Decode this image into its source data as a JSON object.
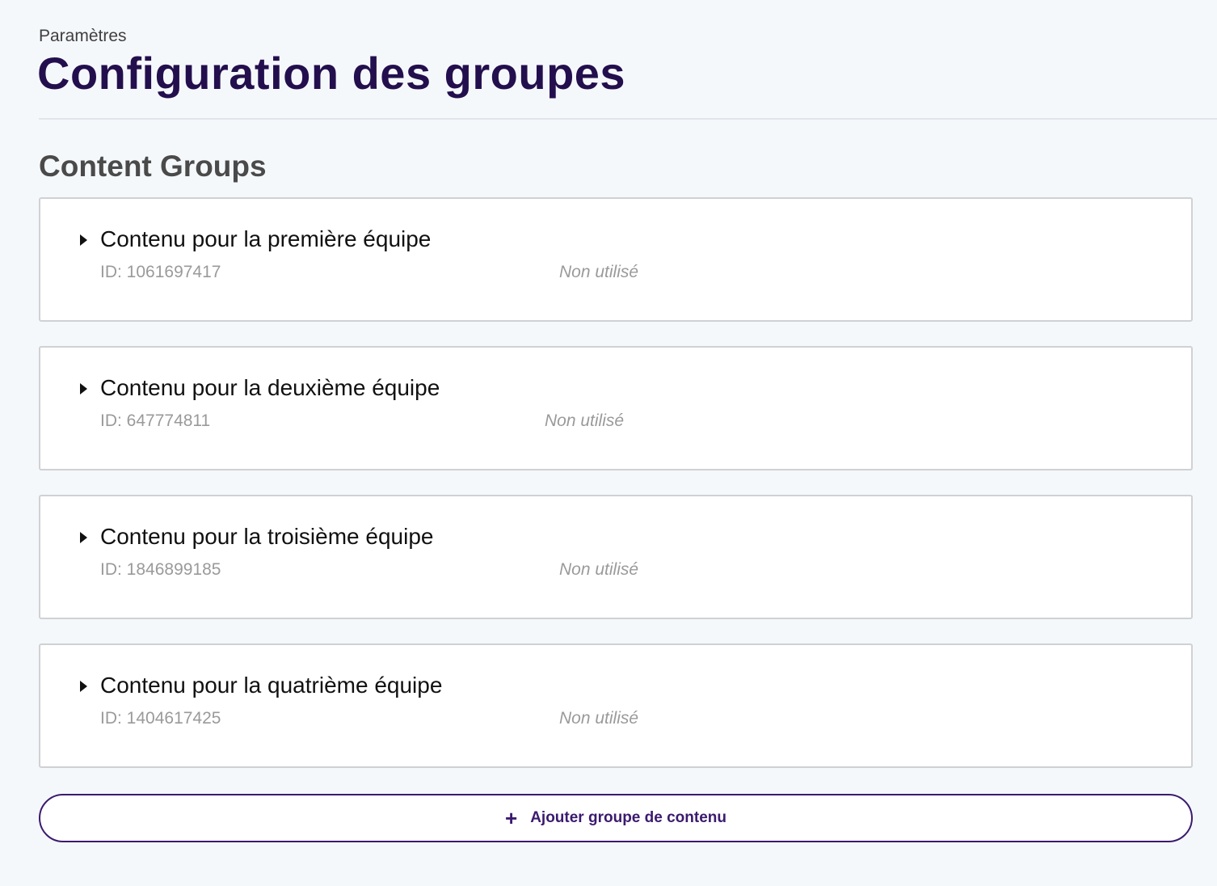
{
  "header": {
    "breadcrumb": "Paramètres",
    "title": "Configuration des groupes"
  },
  "section": {
    "title": "Content Groups"
  },
  "groups": [
    {
      "name": "Contenu pour la première équipe",
      "id_text": "ID: 1061697417",
      "status": "Non utilisé"
    },
    {
      "name": "Contenu pour la deuxième équipe",
      "id_text": "ID: 647774811",
      "status": "Non utilisé"
    },
    {
      "name": "Contenu pour la troisième équipe",
      "id_text": "ID: 1846899185",
      "status": "Non utilisé"
    },
    {
      "name": "Contenu pour la quatrième équipe",
      "id_text": "ID: 1404617425",
      "status": "Non utilisé"
    }
  ],
  "add_button": {
    "icon": "plus-icon",
    "icon_glyph": "+",
    "label": "Ajouter groupe de contenu"
  },
  "colors": {
    "title": "#230f4d",
    "accent": "#3b1a6e",
    "background": "#f5f8fb",
    "muted_text": "#9a9a9a"
  }
}
